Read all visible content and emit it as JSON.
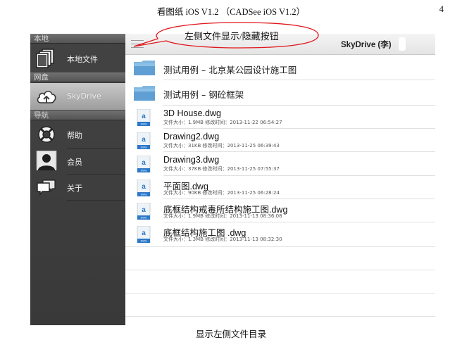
{
  "document": {
    "header": "看图纸 iOS V1.2 （CADSee iOS V1.2）",
    "page_number": "4",
    "caption": "显示左侧文件目录",
    "annotation": "左侧文件显示/隐藏按钮",
    "annotation_color": "#e0161b"
  },
  "sidebar": {
    "sections": [
      {
        "label": "本地"
      },
      {
        "label": "网盘"
      },
      {
        "label": "导航"
      }
    ],
    "items": [
      {
        "label": "本地文件",
        "icon": "files-icon"
      },
      {
        "label": "SkyDrive",
        "icon": "cloud-upload-icon",
        "selected": true
      },
      {
        "label": "帮助",
        "icon": "lifebuoy-icon"
      },
      {
        "label": "会员",
        "icon": "member-avatar-icon"
      },
      {
        "label": "关于",
        "icon": "chat-bubbles-icon"
      }
    ]
  },
  "topbar": {
    "title": "SkyDrive (李)",
    "menu_icon": "hamburger-menu-icon"
  },
  "folders": [
    {
      "name": "测试用例 – 北京某公园设计施工图"
    },
    {
      "name": "测试用例 – 钢砼框架"
    }
  ],
  "files": [
    {
      "name": "3D House.dwg",
      "meta": "文件大小：1.9MB  修改时间：2013-11-22 06:54:27"
    },
    {
      "name": "Drawing2.dwg",
      "meta": "文件大小：31KB  修改时间：2013-11-25 06:39:43"
    },
    {
      "name": "Drawing3.dwg",
      "meta": "文件大小：37KB  修改时间：2013-11-25 07:55:37"
    },
    {
      "name": "平面图.dwg",
      "meta": "文件大小：90KB  修改时间：2013-11-25 06:28:24"
    },
    {
      "name": "底框结构戒毒所结构施工图.dwg",
      "meta": "文件大小：1.9MB  修改时间：2013-11-13 08:36:08"
    },
    {
      "name": "底框结构施工图 .dwg",
      "meta": "文件大小：1.3MB  修改时间：2013-11-13 08:32:30"
    }
  ],
  "file_icon_label": "DWG",
  "colors": {
    "sidebar_bg": "#3d3d3d",
    "folder_blue": "#6aa7d8",
    "dwg_icon_blue": "#2b77c9"
  }
}
